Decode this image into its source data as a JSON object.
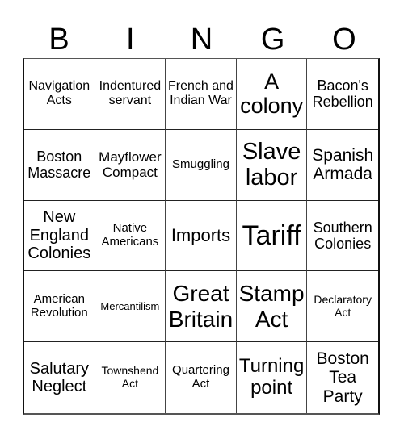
{
  "header": [
    "B",
    "I",
    "N",
    "G",
    "O"
  ],
  "cells": [
    {
      "text": "Navigation Acts",
      "size": 16
    },
    {
      "text": "Indentured servant",
      "size": 16
    },
    {
      "text": "French and Indian War",
      "size": 16
    },
    {
      "text": "A colony",
      "size": 27
    },
    {
      "text": "Bacon's Rebellion",
      "size": 18
    },
    {
      "text": "Boston Massacre",
      "size": 18
    },
    {
      "text": "Mayflower Compact",
      "size": 17
    },
    {
      "text": "Smuggling",
      "size": 15
    },
    {
      "text": "Slave labor",
      "size": 29
    },
    {
      "text": "Spanish Armada",
      "size": 21
    },
    {
      "text": "New England Colonies",
      "size": 20
    },
    {
      "text": "Native Americans",
      "size": 15
    },
    {
      "text": "Imports",
      "size": 22
    },
    {
      "text": "Tariff",
      "size": 34
    },
    {
      "text": "Southern Colonies",
      "size": 18
    },
    {
      "text": "American Revolution",
      "size": 15
    },
    {
      "text": "Mercantilism",
      "size": 13
    },
    {
      "text": "Great Britain",
      "size": 28
    },
    {
      "text": "Stamp Act",
      "size": 28
    },
    {
      "text": "Declaratory Act",
      "size": 14
    },
    {
      "text": "Salutary Neglect",
      "size": 20
    },
    {
      "text": "Townshend Act",
      "size": 14
    },
    {
      "text": "Quartering Act",
      "size": 15
    },
    {
      "text": "Turning point",
      "size": 24
    },
    {
      "text": "Boston Tea Party",
      "size": 21
    }
  ]
}
